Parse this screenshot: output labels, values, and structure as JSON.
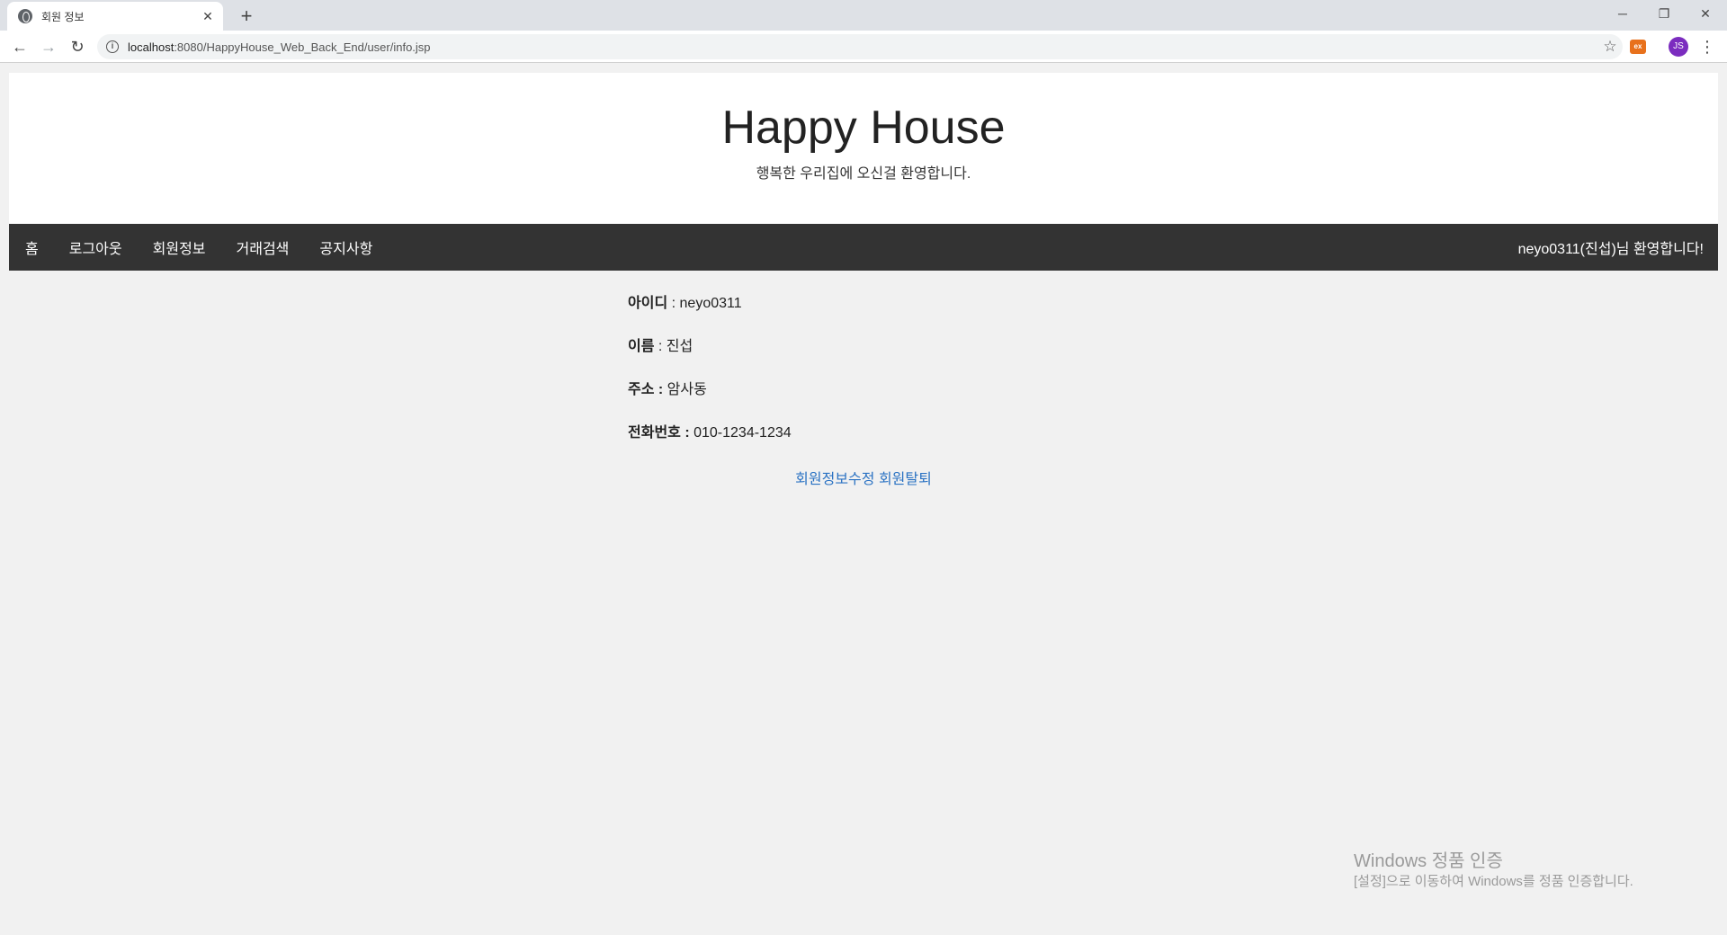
{
  "browser": {
    "tab_title": "회원 정보",
    "url_host": "localhost",
    "url_rest": ":8080/HappyHouse_Web_Back_End/user/info.jsp",
    "avatar_initials": "JS",
    "extension_label": "ex"
  },
  "header": {
    "title": "Happy House",
    "subtitle": "행복한 우리집에 오신걸 환영합니다."
  },
  "nav": {
    "items": [
      "홈",
      "로그아웃",
      "회원정보",
      "거래검색",
      "공지사항"
    ],
    "welcome": "neyo0311(진섭)님 환영합니다!"
  },
  "user_info": {
    "id_label": "아이디",
    "id_sep": " : ",
    "id_value": "neyo0311",
    "name_label": "이름",
    "name_sep": " : ",
    "name_value": "진섭",
    "address_label": "주소 :",
    "address_value": " 암사동",
    "phone_label": "전화번호 :",
    "phone_value": " 010-1234-1234"
  },
  "actions": {
    "edit": "회원정보수정",
    "withdraw": "회원탈퇴"
  },
  "watermark": {
    "title": "Windows 정품 인증",
    "subtitle": "[설정]으로 이동하여 Windows를 정품 인증합니다."
  },
  "colors": {
    "navbar": "#333333",
    "link": "#2a72c3",
    "background": "#f1f1f1"
  }
}
